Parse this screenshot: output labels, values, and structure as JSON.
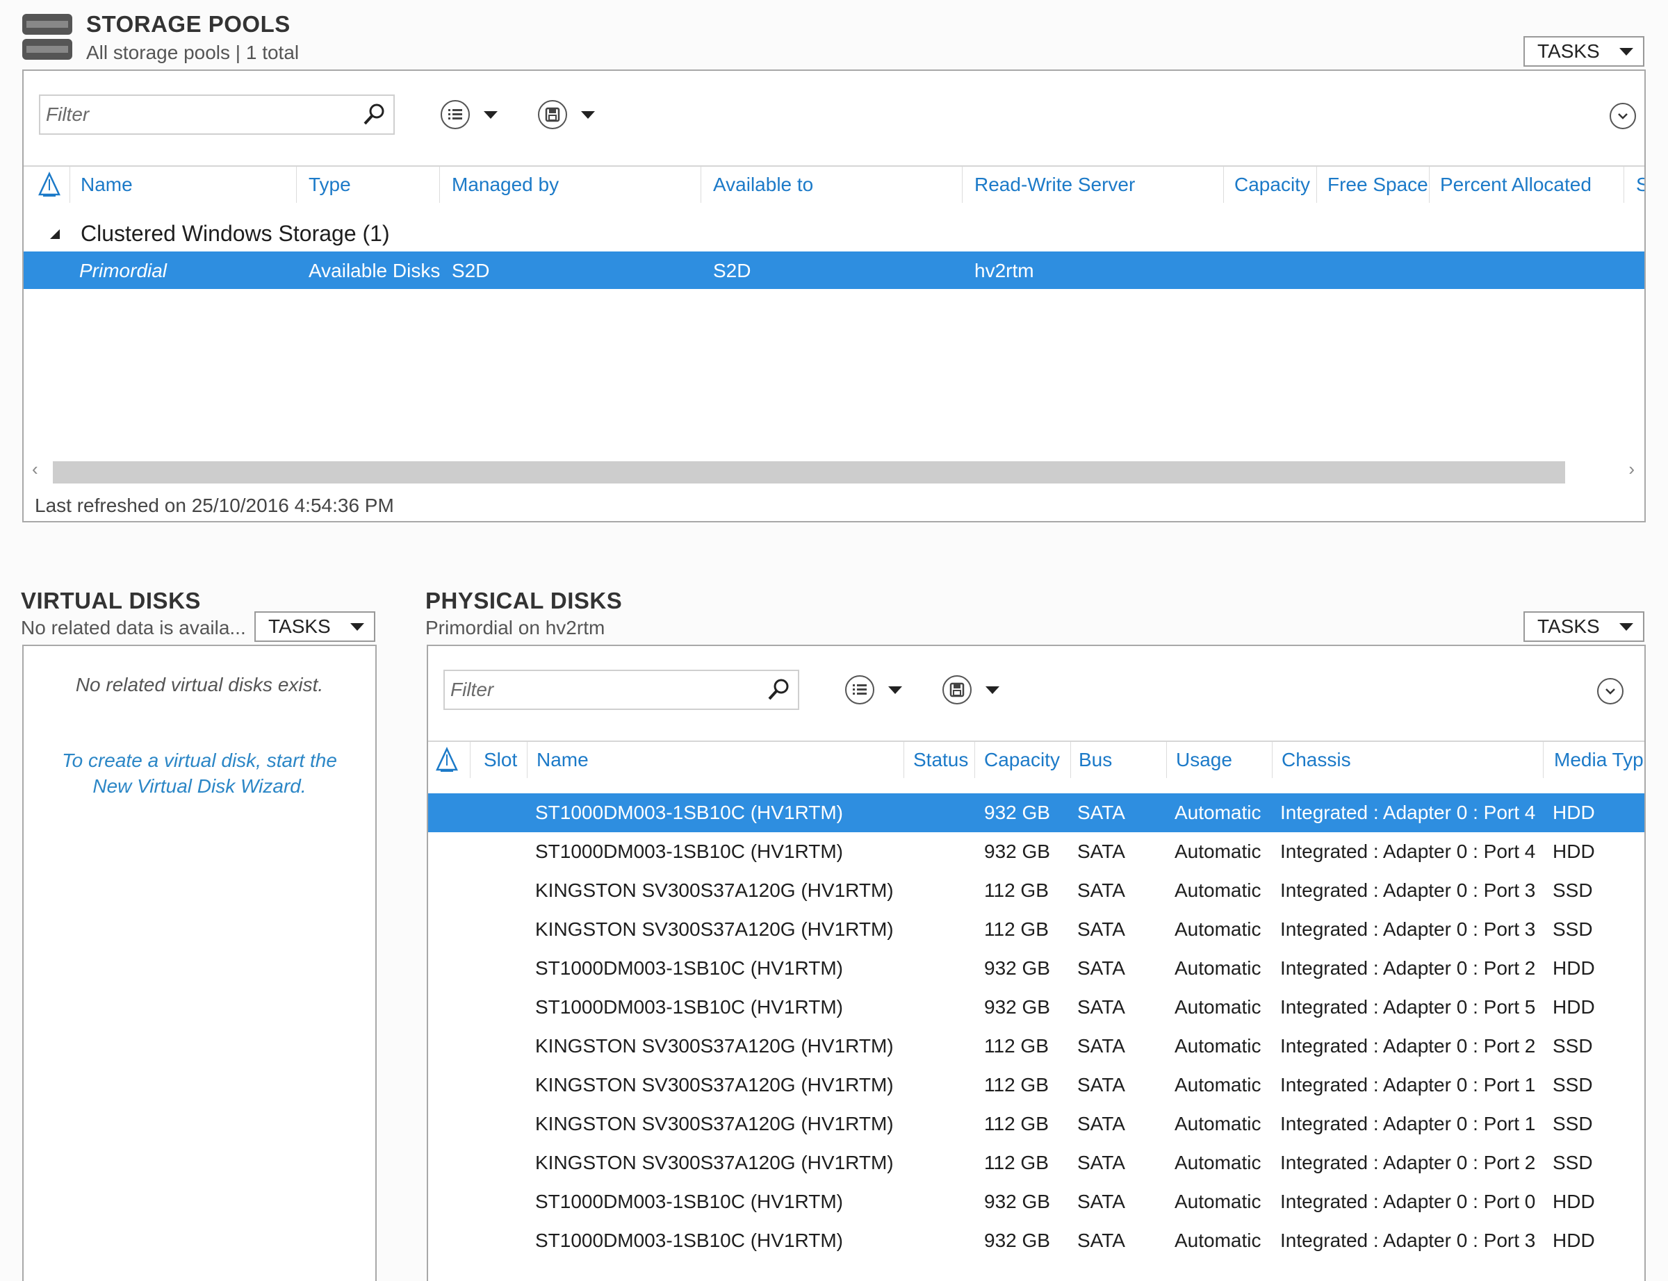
{
  "storage_pools": {
    "title": "STORAGE POOLS",
    "subtitle": "All storage pools | 1 total",
    "tasks_label": "TASKS",
    "filter_placeholder": "Filter",
    "columns": [
      "Name",
      "Type",
      "Managed by",
      "Available to",
      "Read-Write Server",
      "Capacity",
      "Free Space",
      "Percent Allocated",
      "S"
    ],
    "group_label": "Clustered Windows Storage (1)",
    "rows": [
      {
        "name": "Primordial",
        "type": "Available Disks",
        "managed_by": "S2D",
        "available_to": "S2D",
        "rw_server": "hv2rtm"
      }
    ],
    "last_refreshed": "Last refreshed on 25/10/2016 4:54:36 PM"
  },
  "virtual_disks": {
    "title": "VIRTUAL DISKS",
    "subtitle": "No related data is availa...",
    "tasks_label": "TASKS",
    "empty_message": "No related virtual disks exist.",
    "wizard_line1": "To create a virtual disk, start the",
    "wizard_line2": "New Virtual Disk Wizard."
  },
  "physical_disks": {
    "title": "PHYSICAL DISKS",
    "subtitle": "Primordial on hv2rtm",
    "tasks_label": "TASKS",
    "filter_placeholder": "Filter",
    "columns": [
      "Slot",
      "Name",
      "Status",
      "Capacity",
      "Bus",
      "Usage",
      "Chassis",
      "Media Typ"
    ],
    "rows": [
      {
        "name": "ST1000DM003-1SB10C (HV1RTM)",
        "capacity": "932 GB",
        "bus": "SATA",
        "usage": "Automatic",
        "chassis": "Integrated : Adapter 0 : Port 4",
        "media": "HDD"
      },
      {
        "name": "ST1000DM003-1SB10C (HV1RTM)",
        "capacity": "932 GB",
        "bus": "SATA",
        "usage": "Automatic",
        "chassis": "Integrated : Adapter 0 : Port 4",
        "media": "HDD"
      },
      {
        "name": "KINGSTON SV300S37A120G (HV1RTM)",
        "capacity": "112 GB",
        "bus": "SATA",
        "usage": "Automatic",
        "chassis": "Integrated : Adapter 0 : Port 3",
        "media": "SSD"
      },
      {
        "name": "KINGSTON SV300S37A120G (HV1RTM)",
        "capacity": "112 GB",
        "bus": "SATA",
        "usage": "Automatic",
        "chassis": "Integrated : Adapter 0 : Port 3",
        "media": "SSD"
      },
      {
        "name": "ST1000DM003-1SB10C (HV1RTM)",
        "capacity": "932 GB",
        "bus": "SATA",
        "usage": "Automatic",
        "chassis": "Integrated : Adapter 0 : Port 2",
        "media": "HDD"
      },
      {
        "name": "ST1000DM003-1SB10C (HV1RTM)",
        "capacity": "932 GB",
        "bus": "SATA",
        "usage": "Automatic",
        "chassis": "Integrated : Adapter 0 : Port 5",
        "media": "HDD"
      },
      {
        "name": "KINGSTON SV300S37A120G (HV1RTM)",
        "capacity": "112 GB",
        "bus": "SATA",
        "usage": "Automatic",
        "chassis": "Integrated : Adapter 0 : Port 2",
        "media": "SSD"
      },
      {
        "name": "KINGSTON SV300S37A120G (HV1RTM)",
        "capacity": "112 GB",
        "bus": "SATA",
        "usage": "Automatic",
        "chassis": "Integrated : Adapter 0 : Port 1",
        "media": "SSD"
      },
      {
        "name": "KINGSTON SV300S37A120G (HV1RTM)",
        "capacity": "112 GB",
        "bus": "SATA",
        "usage": "Automatic",
        "chassis": "Integrated : Adapter 0 : Port 1",
        "media": "SSD"
      },
      {
        "name": "KINGSTON SV300S37A120G (HV1RTM)",
        "capacity": "112 GB",
        "bus": "SATA",
        "usage": "Automatic",
        "chassis": "Integrated : Adapter 0 : Port 2",
        "media": "SSD"
      },
      {
        "name": "ST1000DM003-1SB10C (HV1RTM)",
        "capacity": "932 GB",
        "bus": "SATA",
        "usage": "Automatic",
        "chassis": "Integrated : Adapter 0 : Port 0",
        "media": "HDD"
      },
      {
        "name": "ST1000DM003-1SB10C (HV1RTM)",
        "capacity": "932 GB",
        "bus": "SATA",
        "usage": "Automatic",
        "chassis": "Integrated : Adapter 0 : Port 3",
        "media": "HDD"
      }
    ]
  },
  "colors": {
    "accent": "#2e8ee0",
    "header_text": "#1c7ac8",
    "link": "#2b86c6"
  }
}
